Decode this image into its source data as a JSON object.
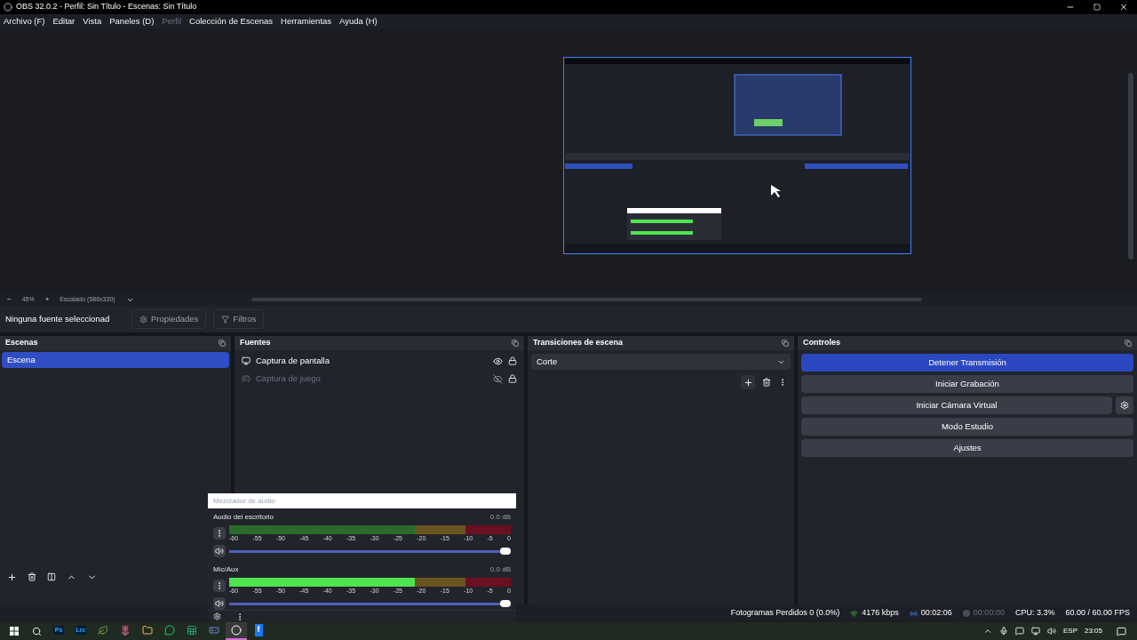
{
  "window": {
    "title": "OBS 32.0.2 - Perfil: Sin Título - Escenas: Sin Título"
  },
  "menu": [
    {
      "label": "Archivo (F)",
      "disabled": false
    },
    {
      "label": "Editar",
      "disabled": false
    },
    {
      "label": "Vista",
      "disabled": false
    },
    {
      "label": "Paneles (D)",
      "disabled": false
    },
    {
      "label": "Perfil",
      "disabled": true
    },
    {
      "label": "Colección de Escenas",
      "disabled": false
    },
    {
      "label": "Herramientas",
      "disabled": false
    },
    {
      "label": "Ayuda (H)",
      "disabled": false
    }
  ],
  "zoom_bar": {
    "minus": "−",
    "zoom": "45%",
    "plus": "+",
    "scale": "Escalado (586x330)"
  },
  "source_toolbar": {
    "status": "Ninguna fuente seleccionad",
    "properties": "Propiedades",
    "filters": "Filtros"
  },
  "scenes": {
    "title": "Escenas",
    "items": [
      {
        "label": "Escena",
        "selected": true
      }
    ]
  },
  "sources": {
    "title": "Fuentes",
    "items": [
      {
        "label": "Captura de pantalla",
        "kind": "monitor",
        "visible": true,
        "locked": true
      },
      {
        "label": "Captura de juego",
        "kind": "gamepad",
        "visible": false,
        "locked": true
      }
    ]
  },
  "transitions": {
    "title": "Transiciones de escena",
    "selected": "Corte"
  },
  "controls": {
    "title": "Controles",
    "buttons": [
      {
        "label": "Detener Transmisión",
        "active": true,
        "has_settings": false
      },
      {
        "label": "Iniciar Grabación",
        "active": false,
        "has_settings": false
      },
      {
        "label": "Iniciar Cámara Virtual",
        "active": false,
        "has_settings": true
      },
      {
        "label": "Modo Estudio",
        "active": false,
        "has_settings": false
      },
      {
        "label": "Ajustes",
        "active": false,
        "has_settings": false
      }
    ]
  },
  "audio_mixer": {
    "title": "Mezclador de audio",
    "channels": [
      {
        "name": "Audio del escritorio",
        "reading": "0.0 dB",
        "signal": false,
        "volume": {
          "level": 1
        },
        "scale": [
          "-60",
          "-55",
          "-50",
          "-45",
          "-40",
          "-35",
          "-30",
          "-25",
          "-20",
          "-15",
          "-10",
          "-5",
          "0"
        ]
      },
      {
        "name": "Mic/Aux",
        "reading": "0.0 dB",
        "signal": true,
        "volume": {
          "level": 1
        },
        "scale": [
          "-60",
          "-55",
          "-50",
          "-45",
          "-40",
          "-35",
          "-30",
          "-25",
          "-20",
          "-15",
          "-10",
          "-5",
          "0"
        ]
      }
    ]
  },
  "status_bar": {
    "dropped_frames": "Fotogramas Perdidos 0 (0.0%)",
    "bitrate": "4176 kbps",
    "stream_time": "00:02:06",
    "streaming": true,
    "record_time": "00:00:00",
    "recording": false,
    "cpu": "CPU: 3.3%",
    "fps": "60.00 / 60.00 FPS"
  },
  "taskbar": {
    "apps": [
      {
        "kind": "ps",
        "label": "Ps",
        "selected": false
      },
      {
        "kind": "lrc",
        "label": "Lrc",
        "selected": false
      },
      {
        "kind": "leaf",
        "selected": false
      },
      {
        "kind": "flower",
        "selected": false
      },
      {
        "kind": "folder",
        "selected": false
      },
      {
        "kind": "chat",
        "selected": false
      },
      {
        "kind": "sheet",
        "selected": false
      },
      {
        "kind": "discord",
        "selected": false
      },
      {
        "kind": "obs",
        "selected": true
      },
      {
        "kind": "letter",
        "label": "f",
        "selected": false
      }
    ],
    "language": "ESP",
    "clock": "23:05"
  }
}
